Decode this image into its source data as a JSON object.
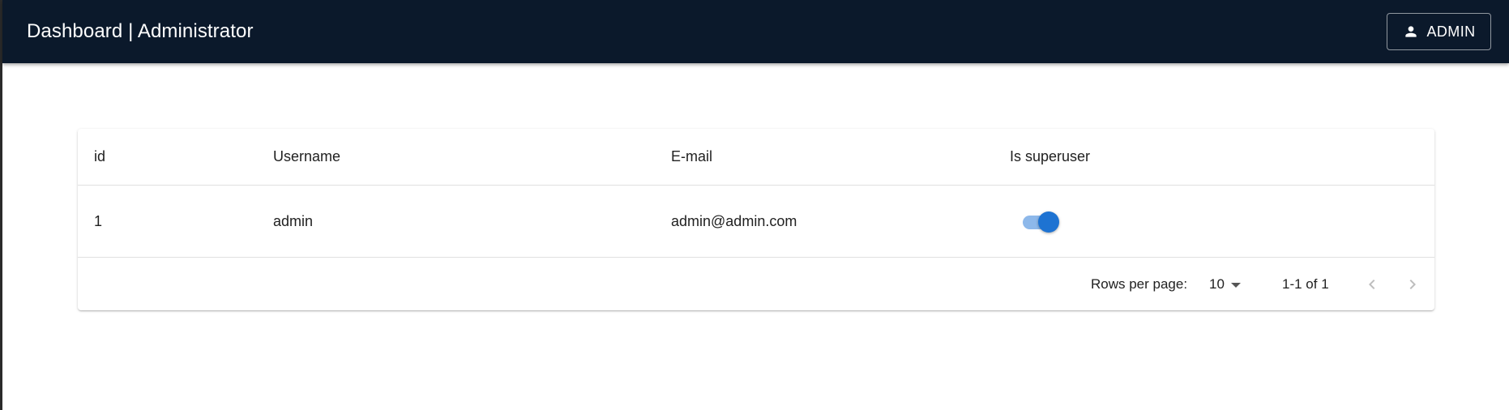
{
  "appbar": {
    "title": "Dashboard | Administrator",
    "user_button_label": "ADMIN",
    "user_icon": "person-icon",
    "background": "#0b192b"
  },
  "table": {
    "columns": [
      "id",
      "Username",
      "E-mail",
      "Is superuser"
    ],
    "rows": [
      {
        "id": "1",
        "username": "admin",
        "email": "admin@admin.com",
        "is_superuser": true
      }
    ]
  },
  "pagination": {
    "rows_per_page_label": "Rows per page:",
    "rows_per_page_value": "10",
    "range_label": "1-1 of 1",
    "prev_icon": "chevron-left-icon",
    "next_icon": "chevron-right-icon"
  },
  "colors": {
    "accent": "#1e73d2",
    "switch_track": "#8db8ea"
  }
}
